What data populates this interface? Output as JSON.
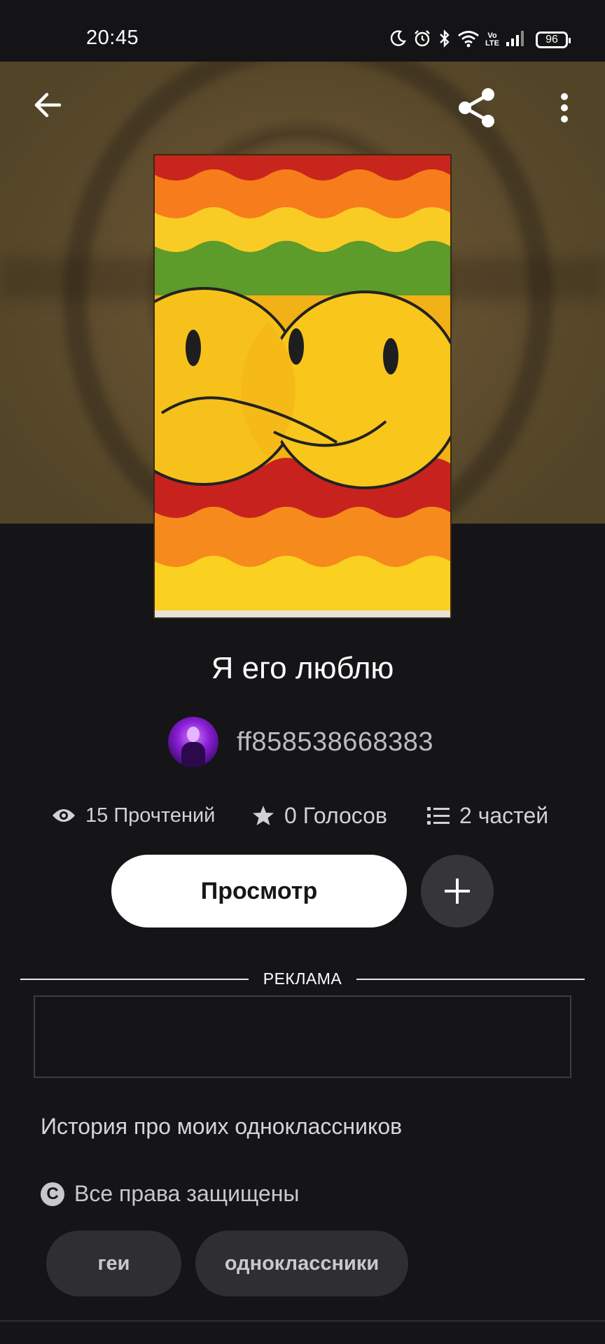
{
  "status_bar": {
    "time": "20:45",
    "battery": "96",
    "network": "Vo LTE",
    "icons": [
      "moon-icon",
      "alarm-icon",
      "bluetooth-icon",
      "wifi-icon",
      "volte-icon",
      "signal-icon",
      "battery-icon"
    ]
  },
  "toolbar": {
    "icons": [
      "back-arrow-icon",
      "share-icon",
      "more-vertical-icon"
    ]
  },
  "story": {
    "title": "Я его люблю",
    "author": "ff858538668383",
    "reads": "15 Прочтений",
    "votes": "0 Голосов",
    "parts": "2 частей",
    "description": "История про моих одноклассников",
    "copyright": "Все права защищены",
    "tags": [
      "геи",
      "одноклассники"
    ]
  },
  "actions": {
    "read_label": "Просмотр",
    "add_icon": "plus-icon"
  },
  "ad": {
    "label": "РЕКЛАМА"
  },
  "colors": {
    "background": "#151417",
    "hero": "#5f4d2e",
    "primary_button": "#ffffff",
    "secondary_button": "#363539",
    "tag_background": "#2f2e32"
  }
}
